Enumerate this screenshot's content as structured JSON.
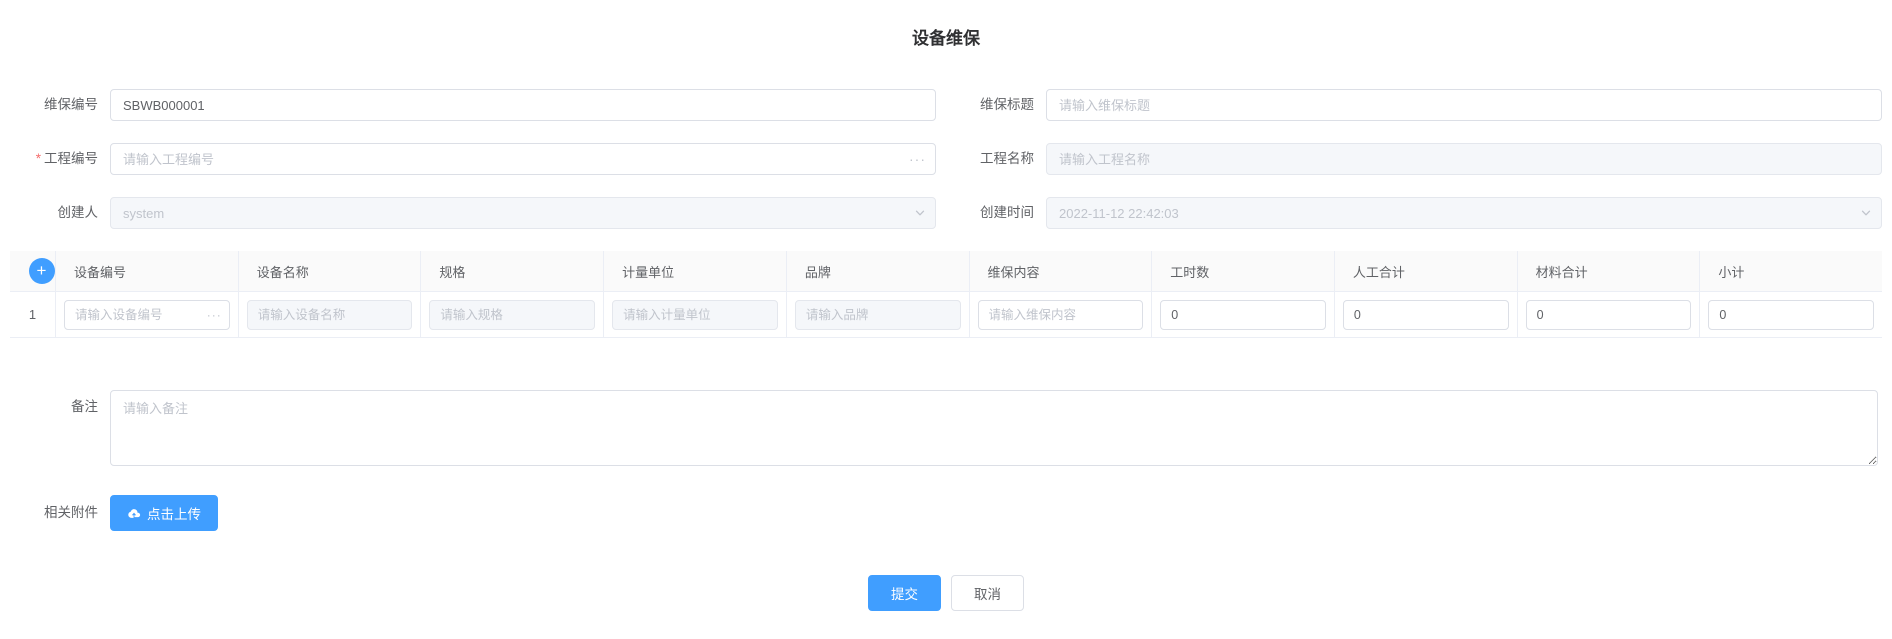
{
  "page": {
    "title": "设备维保"
  },
  "colors": {
    "accent": "#409eff",
    "required": "#f56c6c",
    "input_border": "#dcdfe6",
    "disabled_bg": "#f5f7fa",
    "placeholder": "#c0c4cc",
    "table_border": "#ebeef5"
  },
  "icons": {
    "plus": "+",
    "ellipsis": "···"
  },
  "form": {
    "maintenance_no": {
      "label": "维保编号",
      "value": "SBWB000001"
    },
    "maintenance_title": {
      "label": "维保标题",
      "placeholder": "请输入维保标题"
    },
    "project_no": {
      "label": "工程编号",
      "required": "*",
      "placeholder": "请输入工程编号"
    },
    "project_name": {
      "label": "工程名称",
      "placeholder": "请输入工程名称"
    },
    "creator": {
      "label": "创建人",
      "value": "system"
    },
    "create_time": {
      "label": "创建时间",
      "value": "2022-11-12 22:42:03"
    },
    "remark": {
      "label": "备注",
      "placeholder": "请输入备注"
    },
    "attachment": {
      "label": "相关附件",
      "upload_label": "点击上传"
    }
  },
  "table": {
    "columns": [
      "设备编号",
      "设备名称",
      "规格",
      "计量单位",
      "品牌",
      "维保内容",
      "工时数",
      "人工合计",
      "材料合计",
      "小计"
    ],
    "row": {
      "index": "1",
      "device_no_placeholder": "请输入设备编号",
      "device_name_placeholder": "请输入设备名称",
      "spec_placeholder": "请输入规格",
      "unit_placeholder": "请输入计量单位",
      "brand_placeholder": "请输入品牌",
      "content_placeholder": "请输入维保内容",
      "hours_value": "0",
      "labor_total_value": "0",
      "material_total_value": "0",
      "subtotal_value": "0"
    }
  },
  "footer": {
    "submit_label": "提交",
    "cancel_label": "取消"
  }
}
